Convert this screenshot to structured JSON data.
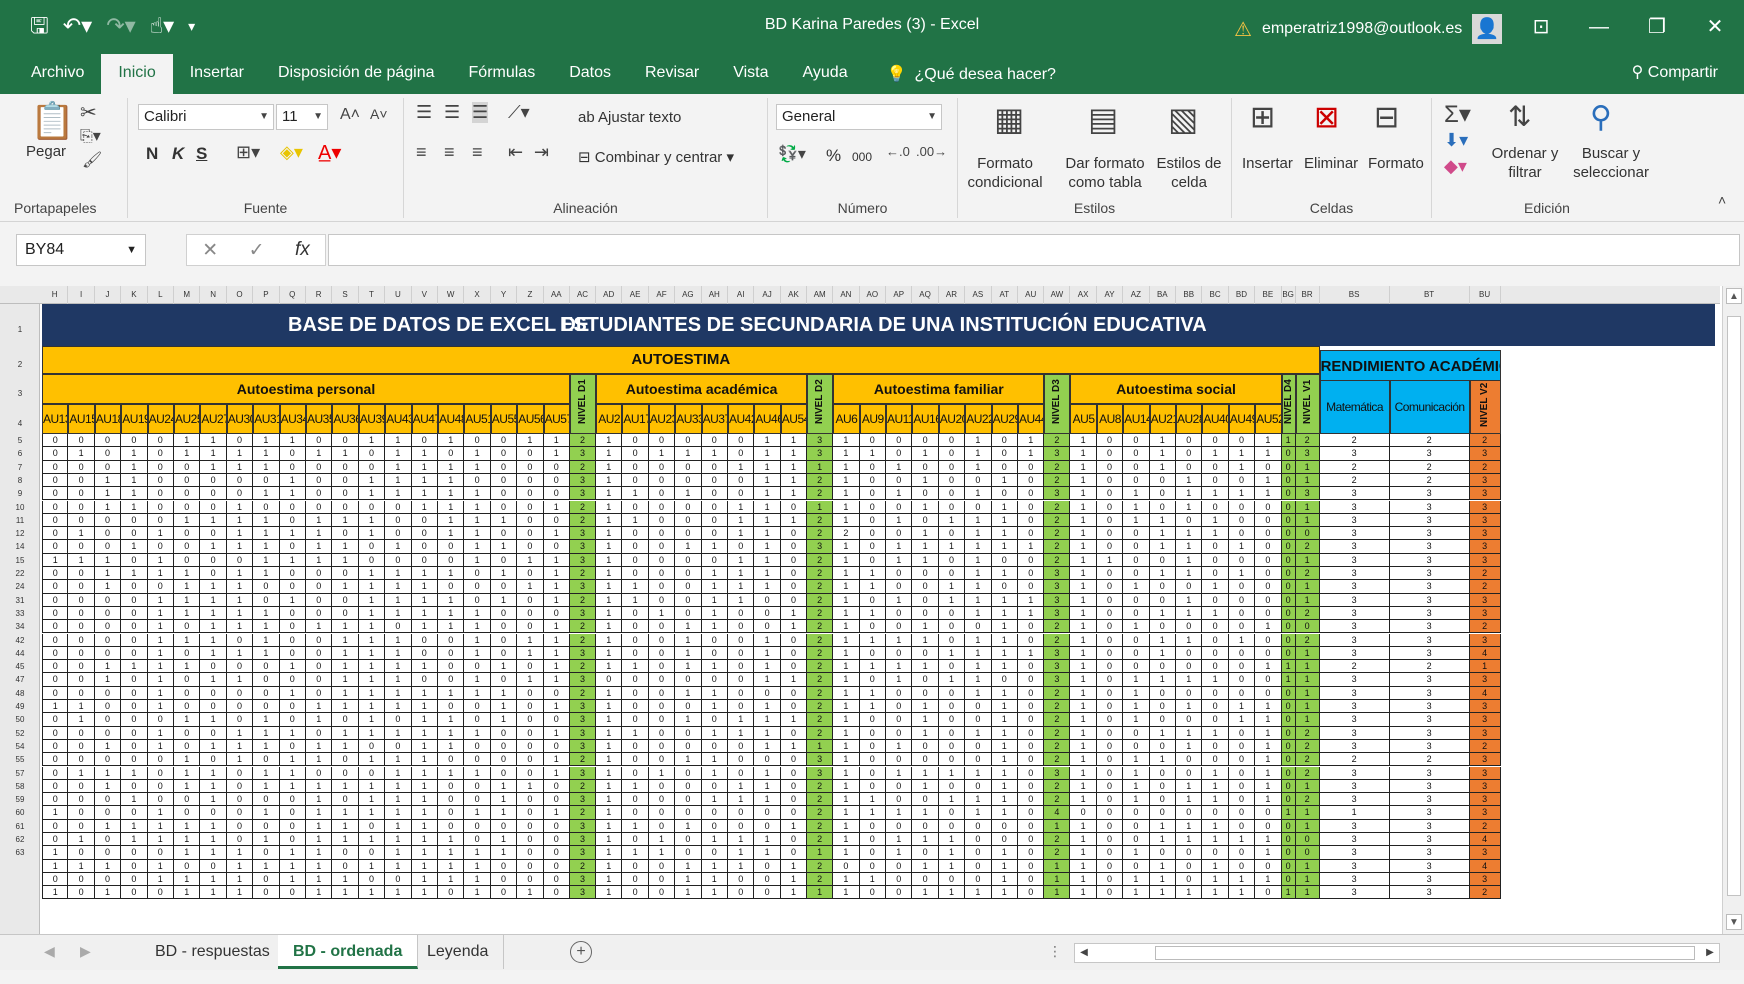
{
  "window": {
    "title": "BD Karina Paredes (3)  -  Excel",
    "account": "emperatriz1998@outlook.es"
  },
  "menu": {
    "tabs": [
      "Archivo",
      "Inicio",
      "Insertar",
      "Disposición de página",
      "Fórmulas",
      "Datos",
      "Revisar",
      "Vista",
      "Ayuda"
    ],
    "active_tab": "Inicio",
    "tell_me": "¿Qué desea hacer?",
    "share": "Compartir"
  },
  "ribbon": {
    "clipboard": {
      "label": "Portapapeles",
      "paste": "Pegar"
    },
    "font": {
      "label": "Fuente",
      "name": "Calibri",
      "size": "11",
      "bold": "N",
      "italic": "K",
      "underline": "S"
    },
    "alignment": {
      "label": "Alineación",
      "wrap": "Ajustar texto",
      "merge": "Combinar y centrar"
    },
    "number": {
      "label": "Número",
      "format": "General",
      "percent": "%",
      "thousands": "000"
    },
    "styles": {
      "label": "Estilos",
      "conditional": "Formato condicional",
      "table": "Dar formato como tabla",
      "cell": "Estilos de celda"
    },
    "cells": {
      "label": "Celdas",
      "insert": "Insertar",
      "delete": "Eliminar",
      "format": "Formato"
    },
    "editing": {
      "label": "Edición",
      "sort": "Ordenar y filtrar",
      "find": "Buscar y seleccionar"
    }
  },
  "formula_bar": {
    "name_box": "BY84",
    "fx": "fx",
    "value": ""
  },
  "sheet": {
    "column_letters": [
      "H",
      "I",
      "J",
      "K",
      "L",
      "M",
      "N",
      "O",
      "P",
      "Q",
      "R",
      "S",
      "T",
      "U",
      "V",
      "W",
      "X",
      "Y",
      "Z",
      "AA",
      "AC",
      "AD",
      "AE",
      "AF",
      "AG",
      "AH",
      "AI",
      "AJ",
      "AK",
      "AM",
      "AN",
      "AO",
      "AP",
      "AQ",
      "AR",
      "AS",
      "AT",
      "AU",
      "AW",
      "AX",
      "AY",
      "AZ",
      "BA",
      "BB",
      "BC",
      "BD",
      "BE",
      "BG",
      "BR",
      "BS",
      "BT",
      "BU"
    ],
    "banner_left": "BASE DE DATOS DE EXCEL DE",
    "banner_right": "ESTUDIANTES DE SECUNDARIA DE UNA INSTITUCIÓN EDUCATIVA",
    "autoestima": "AUTOESTIMA",
    "rendimiento": "RENDIMIENTO ACADÉMICO",
    "sections": [
      {
        "title": "Autoestima personal",
        "items": [
          "AU13",
          "AU15",
          "AU18",
          "AU19",
          "AU24",
          "AU25",
          "AU27",
          "AU30",
          "AU31",
          "AU34",
          "AU35",
          "AU36",
          "AU39",
          "AU43",
          "AU47",
          "AU48",
          "AU51",
          "AU55",
          "AU56",
          "AU57"
        ],
        "nivel": "NIVEL D1"
      },
      {
        "title": "Autoestima académica",
        "items": [
          "AU2",
          "AU17",
          "AU23",
          "AU33",
          "AU37",
          "AU42",
          "AU46",
          "AU54"
        ],
        "nivel": "NIVEL D2"
      },
      {
        "title": "Autoestima familiar",
        "items": [
          "AU6",
          "AU9",
          "AU11",
          "AU16",
          "AU20",
          "AU22",
          "AU29",
          "AU44"
        ],
        "nivel": "NIVEL D3"
      },
      {
        "title": "Autoestima social",
        "items": [
          "AU5",
          "AU8",
          "AU14",
          "AU21",
          "AU28",
          "AU40",
          "AU49",
          "AU52"
        ],
        "nivel": "NIVEL D4"
      }
    ],
    "nivel_v1": "NIVEL V1",
    "nivel_v2": "NIVEL V2",
    "rend_cols": [
      "Matemática",
      "Comunicación"
    ],
    "row_numbers": [
      "1",
      "2",
      "3",
      "4",
      "5",
      "6",
      "7",
      "8",
      "9",
      "10",
      "11",
      "12",
      "14",
      "15",
      "22",
      "24",
      "31",
      "33",
      "34",
      "42",
      "44",
      "45",
      "47",
      "48",
      "49",
      "50",
      "52",
      "54",
      "55",
      "57",
      "58",
      "59",
      "60",
      "61",
      "62",
      "63"
    ],
    "rows": [
      "00000110110011010011210000011310000101210010001122222",
      "01010111101101101001310111011311010101310010111033333",
      "00010011100001111000210000111110100100210010010012222",
      "00110000010011110000310000011210010010210001001012233",
      "00110000110011111000311010011210100100310101111033333",
      "00110001000000111001210000110110010010210101000013333",
      "00000111101110011100211000111210101110210110100013333",
      "01001001111010011001310000110220010110210011100003333",
      "00010011101101001100310011010310111111210011010023333",
      "11101000111100001011310000110210110100211001000013333",
      "00111101100011110101210001110211000110310011010023322",
      "00100111000111100011311001110211001100310100100013322",
      "00001111010011110101211001100210101111310001000013333",
      "00001111100011111000310101001211000111310011100023333",
      "00001011101110111001210011001210010010210100001003322",
      "00001110100111001011210010010211110110210011010023333",
      "00001011100111001011310010010210001111310010000013344",
      "00111100010111100101211011010211110110310000001112211",
      "00101011000111001011300000011210101100310111100113333",
      "00001000010111111100210011000211000110210100000013344",
      "11001000001111100101310001010211010010210101011013333",
      "01000110101010110100310010111210010010210100011013333",
      "00001001110111111001311001110210010110210011101023333",
      "00101011101100110000310000011110100010210001001023322",
      "00000101011011100001210011000310000010210110001022233",
      "01110110110001111001310101010310111110310100101023333",
      "00100110111111100110211000110210010010210101101013333",
      "00010010001011100100310001110211001110210101101023333",
      "10001000101111101101210000000211110110400000000111333",
      "00111110001101100000311010001210000000110011100013322",
      "01011110101111110100310101110210111000210011111003344",
      "10000111011001111100311100110110101010210100001003333",
      "11101001111011111000210011101200011010110010100013344",
      "00001111011100111000310011001211000010110110111013333",
      "10100111001111101010310011001110011110110111110113322"
    ]
  },
  "sheet_tabs": [
    "BD - respuestas",
    "BD - ordenada",
    "Leyenda"
  ],
  "active_sheet": "BD - ordenada",
  "colors": {
    "excel_green": "#217346",
    "banner": "#1f3864",
    "autoestima_band": "#ffc000",
    "nivel_green": "#92d050",
    "rendimiento": "#00b0f0",
    "nivel_v2": "#ed7d31"
  }
}
